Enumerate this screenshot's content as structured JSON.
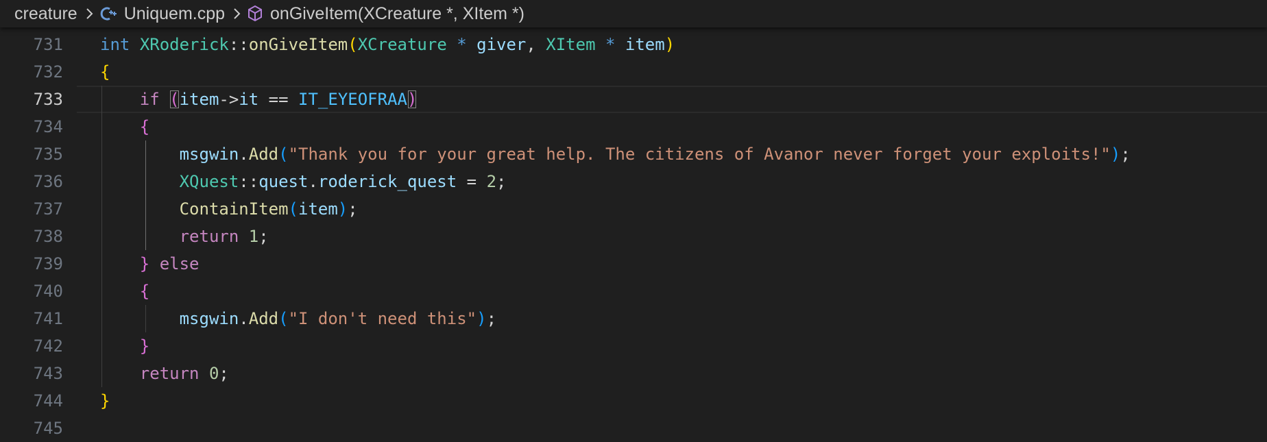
{
  "breadcrumb": {
    "folder": "creature",
    "file": "Uniquem.cpp",
    "symbol": "onGiveItem(XCreature *, XItem *)",
    "file_icon": "cpp-file-icon",
    "symbol_icon": "method-cube-icon",
    "separator_icon": "chevron-right-icon"
  },
  "editor": {
    "active_line": 733,
    "lines": [
      {
        "num": "731",
        "tokens": [
          {
            "t": "int",
            "c": "kw"
          },
          {
            "t": " ",
            "c": "plain"
          },
          {
            "t": "XRoderick",
            "c": "typ"
          },
          {
            "t": "::",
            "c": "plain"
          },
          {
            "t": "onGiveItem",
            "c": "fn"
          },
          {
            "t": "(",
            "c": "b1"
          },
          {
            "t": "XCreature",
            "c": "typ"
          },
          {
            "t": " ",
            "c": "plain"
          },
          {
            "t": "*",
            "c": "kw"
          },
          {
            "t": " ",
            "c": "plain"
          },
          {
            "t": "giver",
            "c": "var"
          },
          {
            "t": ", ",
            "c": "plain"
          },
          {
            "t": "XItem",
            "c": "typ"
          },
          {
            "t": " ",
            "c": "plain"
          },
          {
            "t": "*",
            "c": "kw"
          },
          {
            "t": " ",
            "c": "plain"
          },
          {
            "t": "item",
            "c": "var"
          },
          {
            "t": ")",
            "c": "b1"
          }
        ]
      },
      {
        "num": "732",
        "tokens": [
          {
            "t": "{",
            "c": "b1"
          }
        ]
      },
      {
        "num": "733",
        "tokens": [
          {
            "t": "    ",
            "c": "plain"
          },
          {
            "t": "if",
            "c": "ctl"
          },
          {
            "t": " ",
            "c": "plain"
          },
          {
            "t": "(",
            "c": "b2",
            "box": true
          },
          {
            "t": "item",
            "c": "var"
          },
          {
            "t": "->",
            "c": "plain"
          },
          {
            "t": "it",
            "c": "var"
          },
          {
            "t": " == ",
            "c": "plain"
          },
          {
            "t": "IT_EYEOFRAA",
            "c": "cst"
          },
          {
            "t": ")",
            "c": "b2",
            "box": true
          }
        ]
      },
      {
        "num": "734",
        "tokens": [
          {
            "t": "    ",
            "c": "plain"
          },
          {
            "t": "{",
            "c": "b2"
          }
        ]
      },
      {
        "num": "735",
        "tokens": [
          {
            "t": "        ",
            "c": "plain"
          },
          {
            "t": "msgwin",
            "c": "var"
          },
          {
            "t": ".",
            "c": "plain"
          },
          {
            "t": "Add",
            "c": "fn"
          },
          {
            "t": "(",
            "c": "b3"
          },
          {
            "t": "\"Thank you for your great help. The citizens of Avanor never forget your exploits!\"",
            "c": "str"
          },
          {
            "t": ")",
            "c": "b3"
          },
          {
            "t": ";",
            "c": "plain"
          }
        ]
      },
      {
        "num": "736",
        "tokens": [
          {
            "t": "        ",
            "c": "plain"
          },
          {
            "t": "XQuest",
            "c": "typ"
          },
          {
            "t": "::",
            "c": "plain"
          },
          {
            "t": "quest",
            "c": "var"
          },
          {
            "t": ".",
            "c": "plain"
          },
          {
            "t": "roderick_quest",
            "c": "var"
          },
          {
            "t": " = ",
            "c": "plain"
          },
          {
            "t": "2",
            "c": "num"
          },
          {
            "t": ";",
            "c": "plain"
          }
        ]
      },
      {
        "num": "737",
        "tokens": [
          {
            "t": "        ",
            "c": "plain"
          },
          {
            "t": "ContainItem",
            "c": "fn"
          },
          {
            "t": "(",
            "c": "b3"
          },
          {
            "t": "item",
            "c": "var"
          },
          {
            "t": ")",
            "c": "b3"
          },
          {
            "t": ";",
            "c": "plain"
          }
        ]
      },
      {
        "num": "738",
        "tokens": [
          {
            "t": "        ",
            "c": "plain"
          },
          {
            "t": "return",
            "c": "ctl"
          },
          {
            "t": " ",
            "c": "plain"
          },
          {
            "t": "1",
            "c": "num"
          },
          {
            "t": ";",
            "c": "plain"
          }
        ]
      },
      {
        "num": "739",
        "tokens": [
          {
            "t": "    ",
            "c": "plain"
          },
          {
            "t": "}",
            "c": "b2"
          },
          {
            "t": " ",
            "c": "plain"
          },
          {
            "t": "else",
            "c": "ctl"
          }
        ]
      },
      {
        "num": "740",
        "tokens": [
          {
            "t": "    ",
            "c": "plain"
          },
          {
            "t": "{",
            "c": "b2"
          }
        ]
      },
      {
        "num": "741",
        "tokens": [
          {
            "t": "        ",
            "c": "plain"
          },
          {
            "t": "msgwin",
            "c": "var"
          },
          {
            "t": ".",
            "c": "plain"
          },
          {
            "t": "Add",
            "c": "fn"
          },
          {
            "t": "(",
            "c": "b3"
          },
          {
            "t": "\"I don't need this\"",
            "c": "str"
          },
          {
            "t": ")",
            "c": "b3"
          },
          {
            "t": ";",
            "c": "plain"
          }
        ]
      },
      {
        "num": "742",
        "tokens": [
          {
            "t": "    ",
            "c": "plain"
          },
          {
            "t": "}",
            "c": "b2"
          }
        ]
      },
      {
        "num": "743",
        "tokens": [
          {
            "t": "    ",
            "c": "plain"
          },
          {
            "t": "return",
            "c": "ctl"
          },
          {
            "t": " ",
            "c": "plain"
          },
          {
            "t": "0",
            "c": "num"
          },
          {
            "t": ";",
            "c": "plain"
          }
        ]
      },
      {
        "num": "744",
        "tokens": [
          {
            "t": "}",
            "c": "b1"
          }
        ]
      },
      {
        "num": "745",
        "tokens": []
      }
    ]
  },
  "colors": {
    "background": "#1f1f1f",
    "keyword": "#569cd6",
    "control": "#c586c0",
    "type": "#4ec9b0",
    "function": "#dcdcaa",
    "variable": "#9cdcfe",
    "number": "#b5cea8",
    "string": "#ce9178",
    "constant": "#4fc1ff",
    "bracket_1": "#ffd700",
    "bracket_2": "#da70d6",
    "bracket_3": "#179fff"
  }
}
